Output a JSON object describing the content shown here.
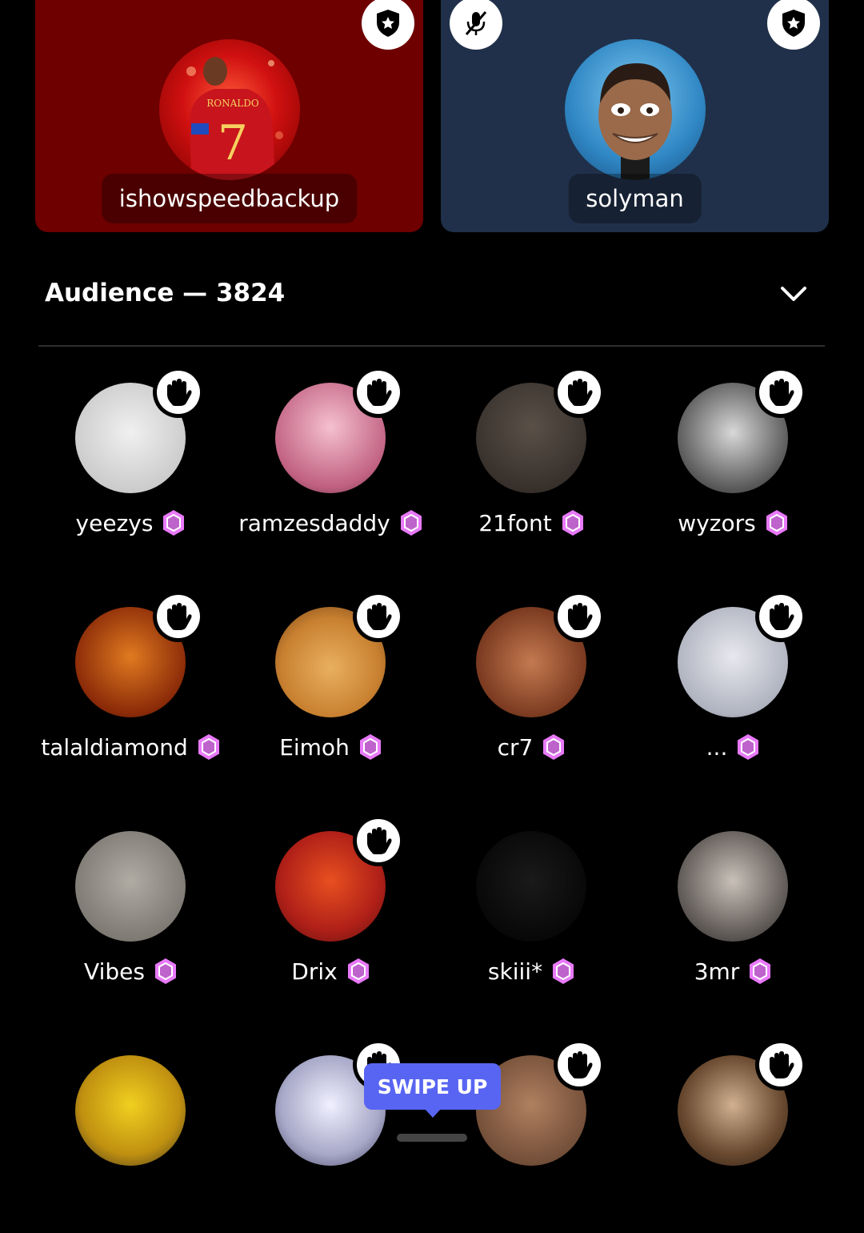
{
  "speakers": [
    {
      "name": "ishowspeedbackup",
      "avatar_icon": "ronaldo-avatar",
      "badge_icon": "moderator-shield-icon",
      "card_color": "#6e0000"
    },
    {
      "name": "solyman",
      "avatar_icon": "cartoon-avatar",
      "badge_icon": "moderator-shield-icon",
      "muted_icon": "mic-muted-icon",
      "card_color": "#20304a"
    }
  ],
  "audience": {
    "header": "Audience — 3824",
    "members": [
      {
        "name": "yeezys",
        "hand_raised": true
      },
      {
        "name": "ramzesdaddy",
        "hand_raised": true
      },
      {
        "name": "21font",
        "hand_raised": true
      },
      {
        "name": "wyzors",
        "hand_raised": true
      },
      {
        "name": "talaldiamond",
        "hand_raised": true
      },
      {
        "name": "Eimoh",
        "hand_raised": true
      },
      {
        "name": "cr7",
        "hand_raised": true
      },
      {
        "name": "...",
        "hand_raised": true
      },
      {
        "name": "Vibes",
        "hand_raised": false
      },
      {
        "name": "Drix",
        "hand_raised": true
      },
      {
        "name": "skiii*",
        "hand_raised": false
      },
      {
        "name": "3mr",
        "hand_raised": false
      },
      {
        "name": "",
        "hand_raised": false
      },
      {
        "name": "",
        "hand_raised": true
      },
      {
        "name": "",
        "hand_raised": true
      },
      {
        "name": "",
        "hand_raised": true
      }
    ]
  },
  "swipe_up": "SWIPE UP",
  "colors": {
    "accent": "#5865f2",
    "nitro_gem": "#e879f9",
    "background": "#000000"
  }
}
